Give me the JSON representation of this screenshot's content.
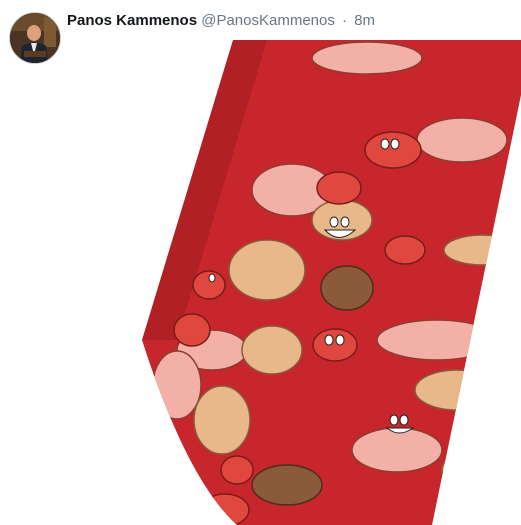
{
  "tweet": {
    "display_name": "Panos Kammenos",
    "handle": "@PanosKammenos",
    "separator": "·",
    "time": "8m"
  },
  "avatar": {
    "icon": "profile-photo"
  },
  "media": {
    "icon": "necktie-photo",
    "colors": {
      "tie_red": "#c6262c",
      "tie_shadow": "#9e1b21",
      "cartoon_pink": "#f2b0a6",
      "cartoon_tan": "#e9b88a",
      "cartoon_brown": "#8a5a3a",
      "cartoon_red": "#e0473f"
    }
  }
}
